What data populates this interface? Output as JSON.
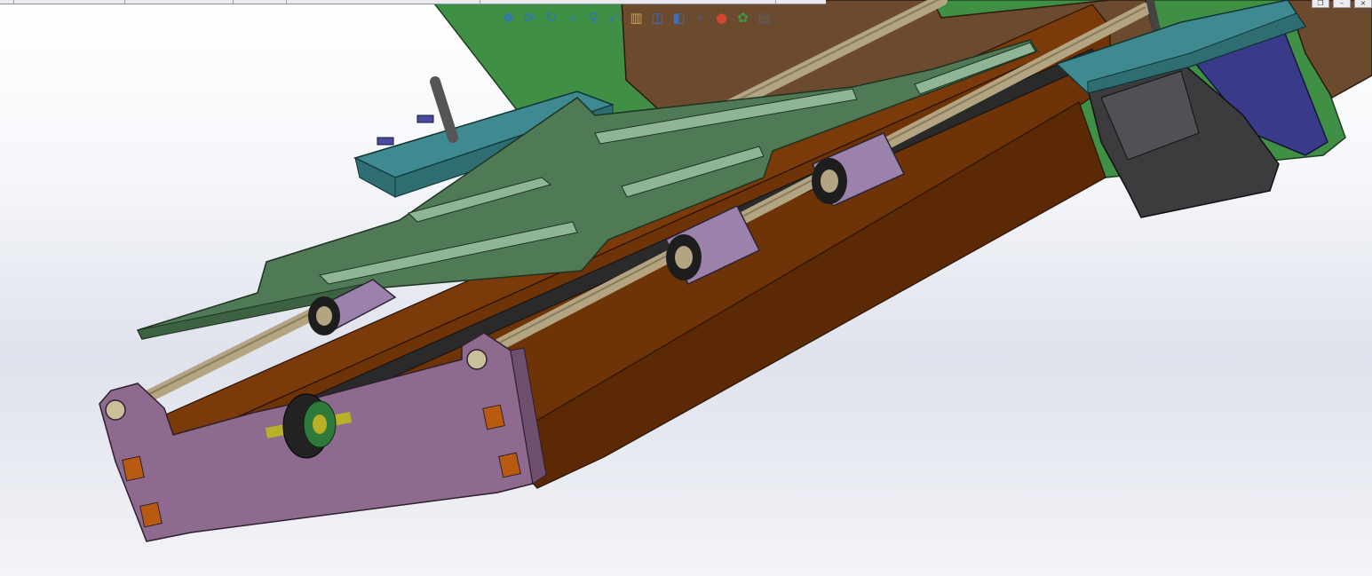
{
  "app": {
    "name": "SolidWorks 3D assembly viewport"
  },
  "heads_up_toolbar": {
    "buttons": [
      {
        "id": "pan",
        "icon": "pan-icon",
        "glyph": "✥",
        "color": "#2f72c8",
        "has_dropdown": false
      },
      {
        "id": "rotate",
        "icon": "rotate-view-icon",
        "glyph": "⟳",
        "color": "#2f72c8",
        "has_dropdown": false
      },
      {
        "id": "roll",
        "icon": "roll-view-icon",
        "glyph": "↻",
        "color": "#2f72c8",
        "has_dropdown": false
      },
      {
        "id": "zoom-to-fit",
        "icon": "zoom-to-fit-icon",
        "glyph": "⌕",
        "color": "#2f72c8",
        "has_dropdown": false
      },
      {
        "id": "zoom-area",
        "icon": "zoom-area-icon",
        "glyph": "⚲",
        "color": "#2f72c8",
        "has_dropdown": false
      },
      {
        "id": "previous-view",
        "icon": "previous-view-icon",
        "glyph": "⤺",
        "color": "#2f72c8",
        "has_dropdown": false
      },
      {
        "id": "section-view",
        "icon": "section-view-icon",
        "glyph": "▥",
        "color": "#d8a23a",
        "has_dropdown": false
      },
      {
        "id": "view-orientation",
        "icon": "view-orientation-icon",
        "glyph": "◫",
        "color": "#3a6fc4",
        "has_dropdown": true
      },
      {
        "id": "display-style",
        "icon": "display-style-icon",
        "glyph": "◧",
        "color": "#3a6fc4",
        "has_dropdown": true
      },
      {
        "id": "hide-show",
        "icon": "hide-show-items-icon",
        "glyph": "⋄",
        "color": "#555a66",
        "has_dropdown": true
      },
      {
        "id": "edit-appearance",
        "icon": "edit-appearance-icon",
        "glyph": "●",
        "color": "#d2462f",
        "has_dropdown": false
      },
      {
        "id": "apply-scene",
        "icon": "apply-scene-icon",
        "glyph": "✿",
        "color": "#3d9a46",
        "has_dropdown": true
      },
      {
        "id": "view-settings",
        "icon": "view-settings-icon",
        "glyph": "▤",
        "color": "#5a5f6a",
        "has_dropdown": true
      }
    ]
  },
  "window_controls": [
    {
      "id": "restore",
      "icon": "restore-icon",
      "glyph": "❐"
    },
    {
      "id": "minimize",
      "icon": "minimize-icon",
      "glyph": "–"
    },
    {
      "id": "close",
      "icon": "close-icon",
      "glyph": "×"
    }
  ],
  "model_colors": {
    "frame_green": "#3f8f45",
    "brown_plate": "#6b4a2e",
    "rail_brown": "#7a3a0a",
    "carriage_plate": "#4f7a55",
    "motor_mount_teal": "#3f8a90",
    "bearing_purple": "#9a82aa",
    "end_block_purple": "#8e6a8e",
    "motor_dark": "#3c3c3e",
    "rod_tan": "#b3a581",
    "bracket_navy": "#3a3a8a"
  }
}
